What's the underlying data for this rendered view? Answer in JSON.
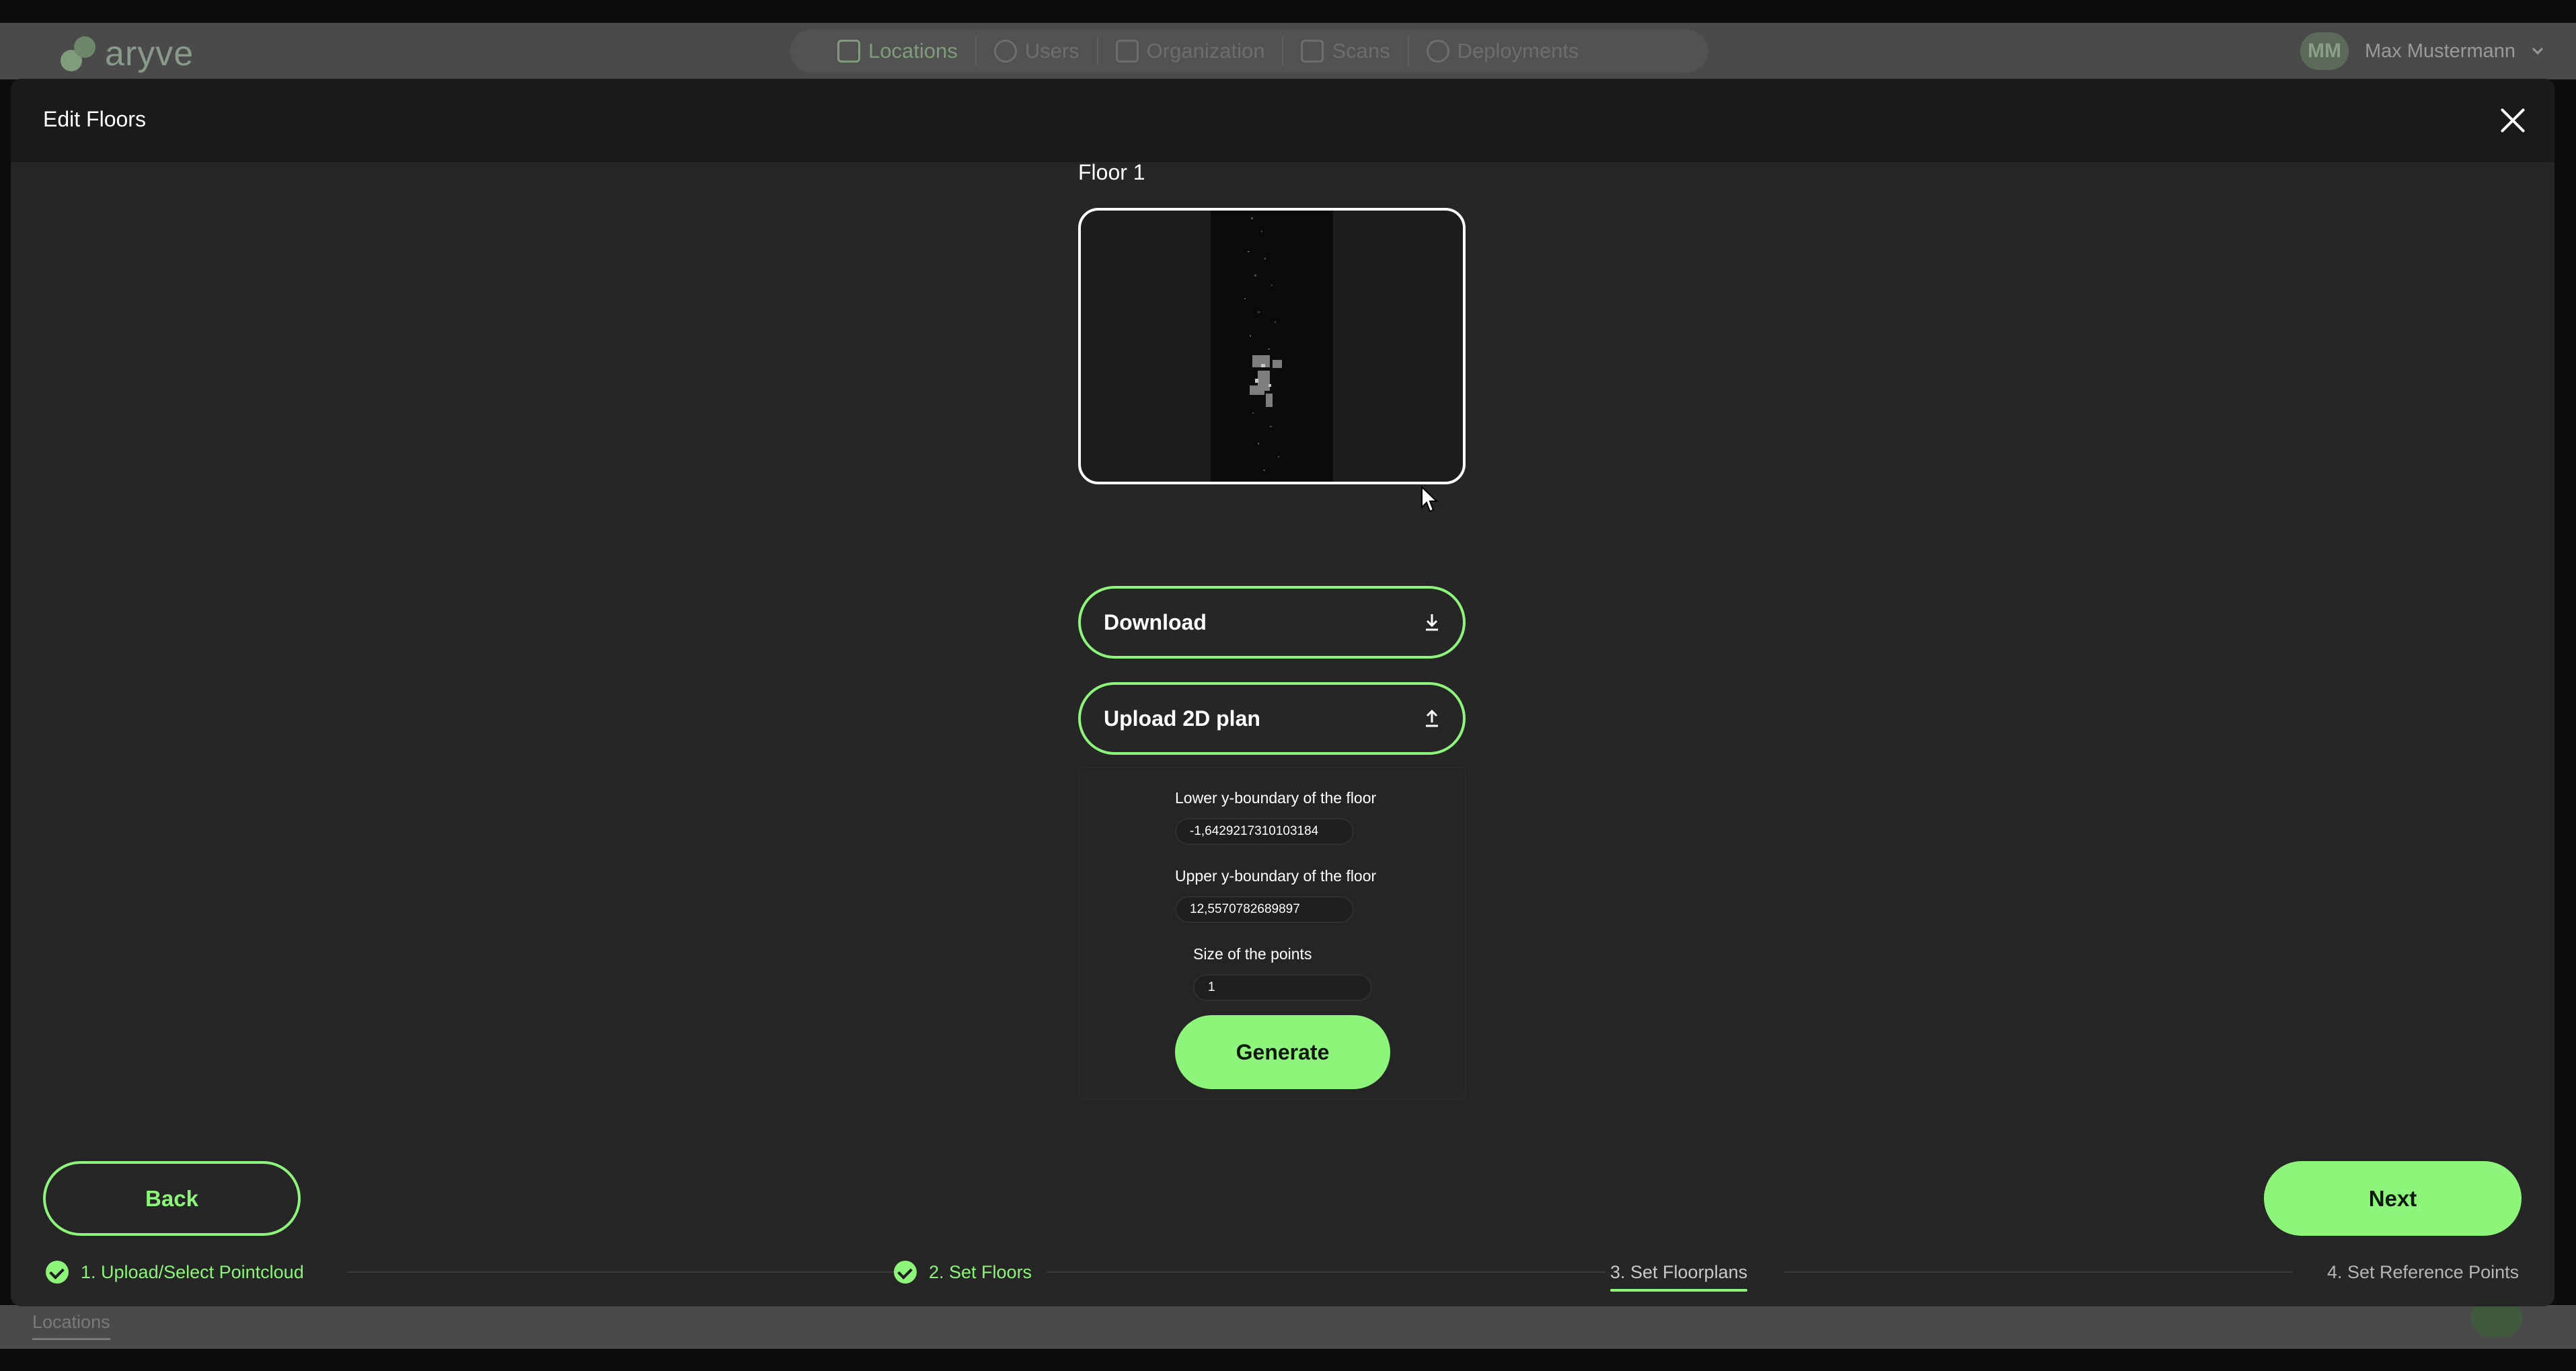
{
  "app": {
    "brand": "aryve",
    "nav": [
      {
        "label": "Locations",
        "icon": "map-icon"
      },
      {
        "label": "Users",
        "icon": "user-icon"
      },
      {
        "label": "Organization",
        "icon": "org-chart-icon"
      },
      {
        "label": "Scans",
        "icon": "scan-icon"
      },
      {
        "label": "Deployments",
        "icon": "gauge-icon"
      }
    ],
    "user": {
      "initials": "MM",
      "name": "Max Mustermann"
    },
    "bottom_tab": "Locations"
  },
  "modal": {
    "title": "Edit Floors",
    "floor_label": "Floor 1",
    "download_label": "Download",
    "upload_label": "Upload 2D plan",
    "fields": {
      "lower_label": "Lower y-boundary of the floor",
      "lower_value": "-1,6429217310103184",
      "upper_label": "Upper y-boundary of the floor",
      "upper_value": "12,5570782689897",
      "size_label": "Size of the points",
      "size_value": "1"
    },
    "generate_label": "Generate",
    "back_label": "Back",
    "next_label": "Next",
    "steps": [
      {
        "label": "1. Upload/Select Pointcloud",
        "state": "done"
      },
      {
        "label": "2. Set Floors",
        "state": "done"
      },
      {
        "label": "3. Set Floorplans",
        "state": "current"
      },
      {
        "label": "4. Set Reference Points",
        "state": "todo"
      }
    ]
  },
  "colors": {
    "accent": "#8cf57a",
    "modal_bg": "#262626",
    "header_bg": "#1a1a1a"
  }
}
